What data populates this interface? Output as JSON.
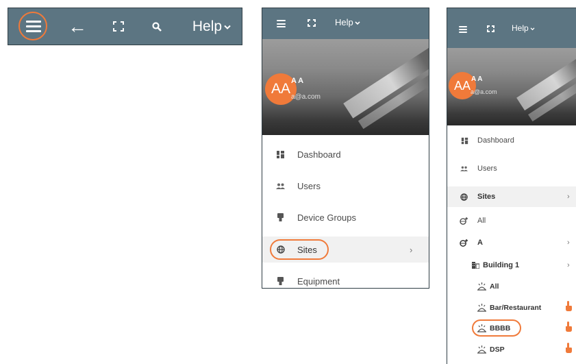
{
  "toolbar": {
    "help_label": "Help",
    "help_chevron": "⌄",
    "back_glyph": "←",
    "search_glyph": "🔍"
  },
  "drawer_small": {
    "help_label": "Help",
    "help_chevron": "⌄"
  },
  "user": {
    "initials": "AA",
    "name": "A A",
    "email": "a@a.com"
  },
  "drawer2": {
    "items": [
      {
        "label": "Dashboard",
        "icon": "dashboard-icon"
      },
      {
        "label": "Users",
        "icon": "users-icon"
      },
      {
        "label": "Device Groups",
        "icon": "device-icon"
      },
      {
        "label": "Sites",
        "icon": "globe-icon",
        "chevron": "›"
      },
      {
        "label": "Equipment",
        "icon": "device-icon"
      }
    ]
  },
  "drawer3": {
    "items": [
      {
        "label": "Dashboard",
        "icon": "dashboard-icon"
      },
      {
        "label": "Users",
        "icon": "users-icon"
      },
      {
        "label": "Sites",
        "icon": "globe-icon",
        "chevron": "›"
      },
      {
        "label": "All",
        "icon": "globe-plus-icon"
      },
      {
        "label": "A",
        "icon": "globe-plus-icon",
        "chevron": "›"
      },
      {
        "label": "Building 1",
        "icon": "building-icon",
        "chevron": "›"
      },
      {
        "label": "All",
        "icon": "location-icon"
      },
      {
        "label": "Bar/Restaurant",
        "icon": "location-icon",
        "tap": true
      },
      {
        "label": "BBBB",
        "icon": "location-icon",
        "tap": true
      },
      {
        "label": "DSP",
        "icon": "location-icon",
        "tap": true
      }
    ]
  },
  "colors": {
    "header": "#5c7582",
    "accent": "#f07a3a",
    "text": "#4a4a4a"
  }
}
